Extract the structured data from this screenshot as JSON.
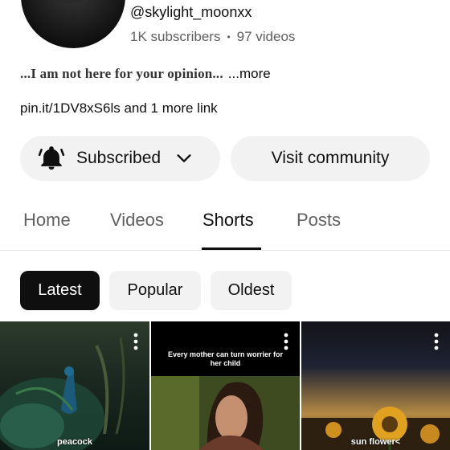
{
  "channel": {
    "handle": "@skylight_moonxx",
    "subscribers": "1K subscribers",
    "separator": "•",
    "videos": "97 videos",
    "description": "...I am not here for your opinion...",
    "more_label": "...more",
    "links": "pin.it/1DV8xS6ls and 1 more link"
  },
  "actions": {
    "subscribed_label": "Subscribed",
    "community_label": "Visit community"
  },
  "tabs": [
    {
      "label": "Home",
      "active": false
    },
    {
      "label": "Videos",
      "active": false
    },
    {
      "label": "Shorts",
      "active": true
    },
    {
      "label": "Posts",
      "active": false
    }
  ],
  "filters": [
    {
      "label": "Latest",
      "active": true
    },
    {
      "label": "Popular",
      "active": false
    },
    {
      "label": "Oldest",
      "active": false
    }
  ],
  "shorts": [
    {
      "caption": "peacock",
      "overlay": ""
    },
    {
      "caption": "",
      "overlay": "Every mother can turn worrier for her child"
    },
    {
      "caption": "sun flower<",
      "overlay": ""
    }
  ]
}
